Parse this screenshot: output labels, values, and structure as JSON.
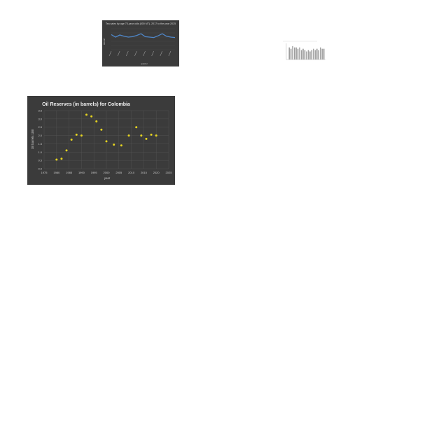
{
  "chart_data": [
    {
      "type": "line",
      "title": "Tea sales by age 75-year olds (000 MT), 2017 to the year 2025",
      "xlabel": "quarter",
      "ylabel": "000 MT",
      "ylim": [
        0,
        5
      ],
      "grid": true,
      "background": "#3b3b3b",
      "series": [
        {
          "values": [
            3.6,
            3.0,
            3.5,
            3.2,
            3.0,
            3.1,
            3.4,
            3.8,
            3.1,
            3.0,
            2.9,
            3.3,
            3.8,
            3.2,
            3.0,
            2.9
          ],
          "color": "#4f87c9"
        }
      ]
    },
    {
      "type": "bar",
      "values": [
        9,
        8,
        10,
        9,
        9,
        8,
        9,
        7,
        8,
        7,
        6,
        7,
        6,
        7,
        8,
        7,
        8,
        7,
        9,
        8,
        8
      ],
      "ylim": [
        0,
        12
      ],
      "background": "#ffffff",
      "bar_color": "#999999"
    },
    {
      "type": "scatter",
      "title": "Oil Reserves (in barrels) for Colombia",
      "xlabel": "year",
      "ylabel": "Oil barrels 10B",
      "xlim": [
        1975,
        2025
      ],
      "ylim": [
        0,
        3.5
      ],
      "xticks": [
        "1975",
        "1980",
        "1985",
        "1990",
        "1995",
        "2000",
        "2005",
        "2010",
        "2015",
        "2020",
        "2025"
      ],
      "yticks": [
        "0.0",
        "0.5",
        "1.0",
        "1.5",
        "2.0",
        "2.5",
        "3.0",
        "3.5"
      ],
      "grid": true,
      "background": "#3b3b3b",
      "point_color": "#e6d420",
      "x": [
        1980,
        1982,
        1984,
        1986,
        1988,
        1990,
        1992,
        1994,
        1996,
        1998,
        2000,
        2003,
        2006,
        2009,
        2012,
        2014,
        2016,
        2018,
        2020
      ],
      "y": [
        0.55,
        0.6,
        1.1,
        1.75,
        2.05,
        2.0,
        3.25,
        3.15,
        2.85,
        2.35,
        1.65,
        1.45,
        1.4,
        2.0,
        2.5,
        2.0,
        1.8,
        2.05,
        2.0
      ]
    }
  ]
}
